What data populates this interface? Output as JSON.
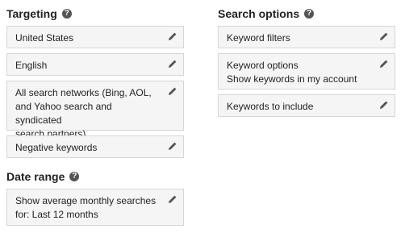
{
  "targeting": {
    "title": "Targeting",
    "items": [
      {
        "label": "United States"
      },
      {
        "label": "English"
      },
      {
        "label": "All search networks (Bing, AOL,\nand Yahoo search and syndicated\nsearch partners)"
      },
      {
        "label": "Negative keywords"
      }
    ]
  },
  "date_range": {
    "title": "Date range",
    "items": [
      {
        "label": "Show average monthly searches\nfor: Last 12 months"
      }
    ]
  },
  "search_options": {
    "title": "Search options",
    "items": [
      {
        "label": "Keyword filters"
      },
      {
        "label": "Keyword options\nShow keywords in my account"
      },
      {
        "label": "Keywords to include"
      }
    ]
  },
  "icons": {
    "help": "help-icon",
    "edit": "pencil-icon"
  },
  "colors": {
    "card_bg": "#f5f5f5",
    "card_border": "#d6d6d6",
    "icon": "#545454"
  }
}
